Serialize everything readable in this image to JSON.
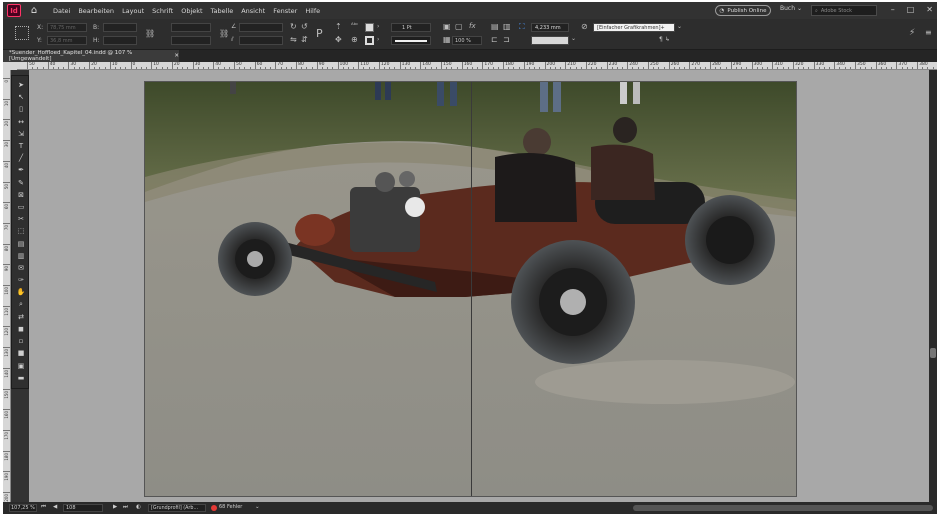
{
  "menu": {
    "app_logo": "Id",
    "items": [
      "Datei",
      "Bearbeiten",
      "Layout",
      "Schrift",
      "Objekt",
      "Tabelle",
      "Ansicht",
      "Fenster",
      "Hilfe"
    ],
    "publish_label": "Publish Online",
    "workspace_label": "Buch",
    "search_placeholder": "Adobe Stock"
  },
  "control": {
    "x_label": "X:",
    "x_value": "78,75 mm",
    "y_label": "Y:",
    "y_value": "36,8 mm",
    "w_label": "B:",
    "h_label": "H:",
    "stroke_weight": "1 Pt",
    "size_value": "4,233 mm",
    "scale_value": "100 %",
    "object_style": "[Einfacher Grafikrahmen]+"
  },
  "document": {
    "tab_title": "*Suender_Hoffloed_Kapitel_04.indd @ 107 % [Umgewandelt]",
    "close_glyph": "✕"
  },
  "ruler": {
    "h_labels": [
      "50",
      "40",
      "30",
      "20",
      "10",
      "0",
      "10",
      "20",
      "30",
      "40",
      "50",
      "60",
      "70",
      "80",
      "90",
      "100",
      "110",
      "120",
      "130",
      "140",
      "150",
      "160",
      "170",
      "180",
      "190",
      "200",
      "210",
      "220",
      "230",
      "240",
      "250",
      "260",
      "270",
      "280",
      "290",
      "300",
      "310",
      "320",
      "330",
      "340",
      "350",
      "360",
      "370",
      "380",
      "390"
    ],
    "v_labels": [
      "0",
      "10",
      "20",
      "30",
      "40",
      "50",
      "60",
      "70",
      "80",
      "90",
      "100",
      "110",
      "120",
      "130",
      "140",
      "150",
      "160",
      "170",
      "180",
      "190",
      "200"
    ]
  },
  "status": {
    "zoom": "107,25 %",
    "page": "108",
    "profile": "[Grundprofil] (Arb...",
    "errors": "68 Fehler"
  },
  "colors": {
    "accent": "#ff3366",
    "error": "#e53935"
  }
}
